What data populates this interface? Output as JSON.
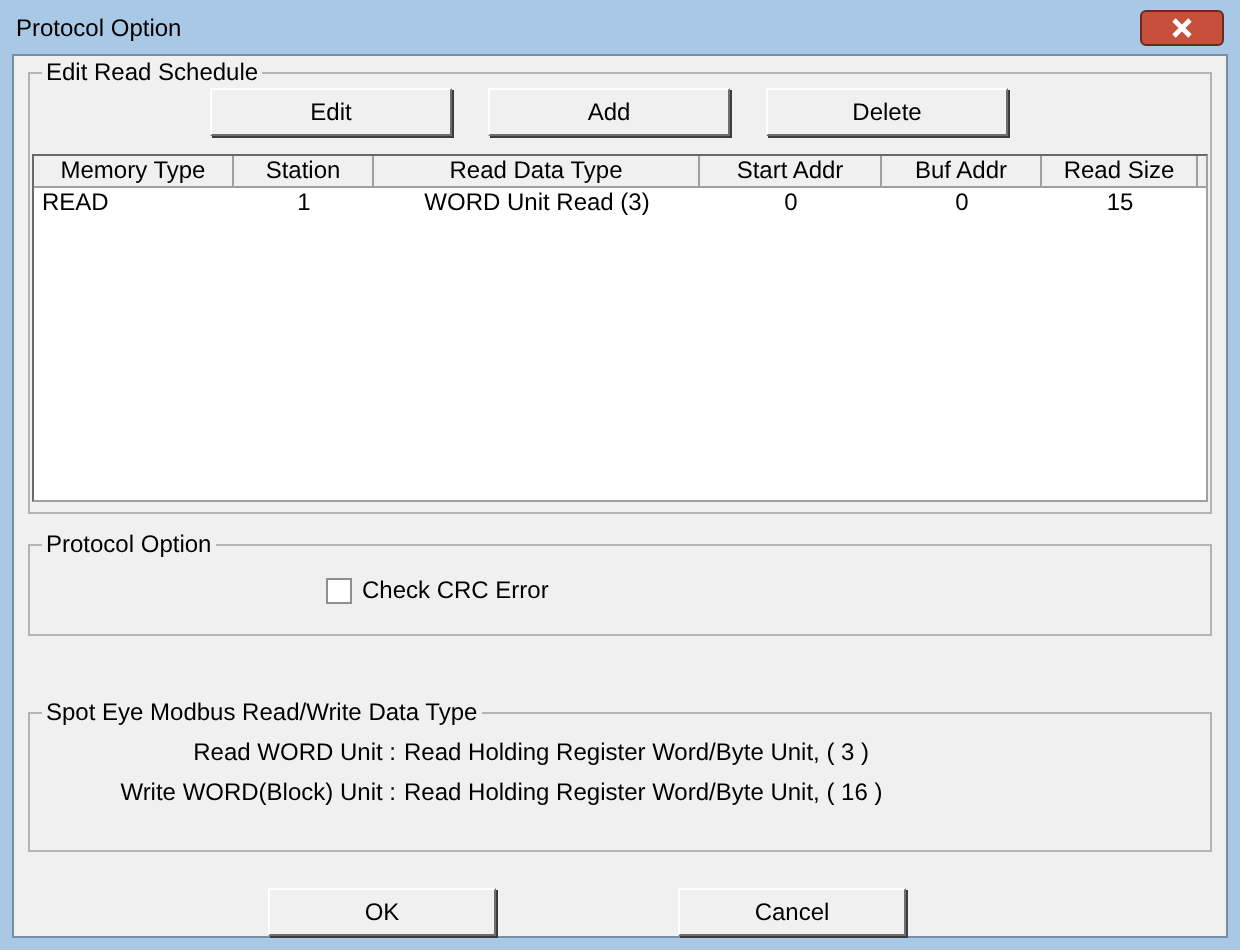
{
  "window": {
    "title": "Protocol Option"
  },
  "schedule": {
    "title": "Edit Read Schedule",
    "buttons": [
      "Edit",
      "Add",
      "Delete"
    ],
    "columns": [
      "Memory Type",
      "Station",
      "Read Data Type",
      "Start Addr",
      "Buf Addr",
      "Read Size"
    ],
    "rows": [
      [
        "READ",
        "1",
        "WORD Unit Read (3)",
        "0",
        "0",
        "15"
      ]
    ]
  },
  "protocol_option": {
    "title": "Protocol Option",
    "checkbox": {
      "label": "Check CRC Error",
      "checked": false
    }
  },
  "data_type": {
    "title": "Spot Eye Modbus Read/Write Data Type",
    "lines": [
      {
        "label": "Read WORD Unit :",
        "value": "Read Holding Register Word/Byte Unit, ( 3  )"
      },
      {
        "label": "Write WORD(Block) Unit :",
        "value": "Read Holding Register Word/Byte Unit, ( 16 )"
      }
    ]
  },
  "buttons": [
    "OK",
    "Cancel"
  ]
}
